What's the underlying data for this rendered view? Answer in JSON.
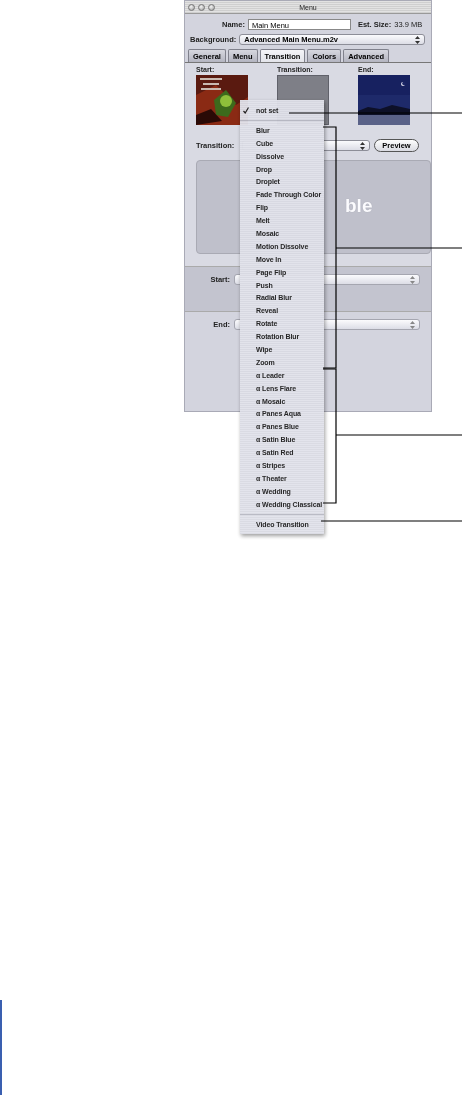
{
  "window": {
    "title": "Menu"
  },
  "name_field": {
    "label": "Name:",
    "value": "Main Menu"
  },
  "est_size": {
    "label": "Est. Size:",
    "value": "33.9 MB"
  },
  "background": {
    "label": "Background:",
    "value": "Advanced Main Menu.m2v"
  },
  "tabs": [
    {
      "label": "General",
      "selected": false
    },
    {
      "label": "Menu",
      "selected": false
    },
    {
      "label": "Transition",
      "selected": true
    },
    {
      "label": "Colors",
      "selected": false
    },
    {
      "label": "Advanced",
      "selected": false
    }
  ],
  "thumbnails": [
    {
      "label": "Start:",
      "kind": "picture"
    },
    {
      "label": "Transition:",
      "kind": "blank"
    },
    {
      "label": "End:",
      "kind": "picture"
    }
  ],
  "transition": {
    "label": "Transition:",
    "button": "Preview"
  },
  "preview": {
    "text": "ble"
  },
  "start": {
    "label": "Start:"
  },
  "end": {
    "label": "End:"
  },
  "menu": {
    "sections": [
      [
        {
          "label": "not set",
          "checked": true
        }
      ],
      [
        {
          "label": "Blur",
          "checked": false
        },
        {
          "label": "Cube",
          "checked": false
        },
        {
          "label": "Dissolve",
          "checked": false
        },
        {
          "label": "Drop",
          "checked": false
        },
        {
          "label": "Droplet",
          "checked": false
        },
        {
          "label": "Fade Through Color",
          "checked": false
        },
        {
          "label": "Flip",
          "checked": false
        },
        {
          "label": "Melt",
          "checked": false
        },
        {
          "label": "Mosaic",
          "checked": false
        },
        {
          "label": "Motion Dissolve",
          "checked": false
        },
        {
          "label": "Move In",
          "checked": false
        },
        {
          "label": "Page Flip",
          "checked": false
        },
        {
          "label": "Push",
          "checked": false
        },
        {
          "label": "Radial Blur",
          "checked": false
        },
        {
          "label": "Reveal",
          "checked": false
        },
        {
          "label": "Rotate",
          "checked": false
        },
        {
          "label": "Rotation Blur",
          "checked": false
        },
        {
          "label": "Wipe",
          "checked": false
        },
        {
          "label": "Zoom",
          "checked": false
        },
        {
          "label": "α Leader",
          "checked": false
        },
        {
          "label": "α Lens Flare",
          "checked": false
        },
        {
          "label": "α Mosaic",
          "checked": false
        },
        {
          "label": "α Panes Aqua",
          "checked": false
        },
        {
          "label": "α Panes Blue",
          "checked": false
        },
        {
          "label": "α Satin Blue",
          "checked": false
        },
        {
          "label": "α Satin Red",
          "checked": false
        },
        {
          "label": "α Stripes",
          "checked": false
        },
        {
          "label": "α Theater",
          "checked": false
        },
        {
          "label": "α Wedding",
          "checked": false
        },
        {
          "label": "α Wedding Classical",
          "checked": false
        }
      ],
      [
        {
          "label": "Video Transition",
          "checked": false
        }
      ]
    ]
  }
}
